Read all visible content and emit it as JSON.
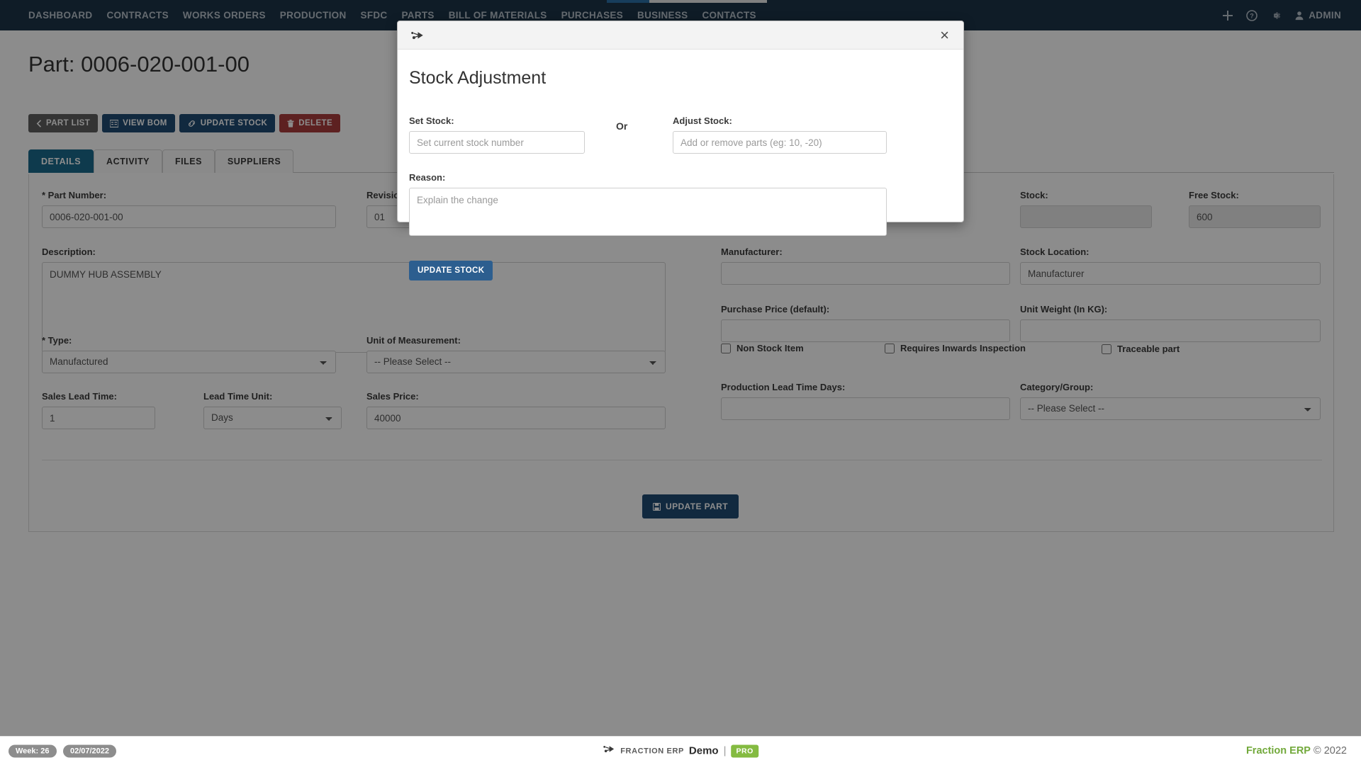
{
  "navbar": {
    "items": [
      {
        "label": "DASHBOARD",
        "name": "nav-dashboard"
      },
      {
        "label": "CONTRACTS",
        "name": "nav-contracts"
      },
      {
        "label": "WORKS ORDERS",
        "name": "nav-works-orders"
      },
      {
        "label": "PRODUCTION",
        "name": "nav-production"
      },
      {
        "label": "SFDC",
        "name": "nav-sfdc"
      },
      {
        "label": "PARTS",
        "name": "nav-parts"
      },
      {
        "label": "BILL OF MATERIALS",
        "name": "nav-bill-of-materials"
      },
      {
        "label": "PURCHASES",
        "name": "nav-purchases"
      },
      {
        "label": "BUSINESS",
        "name": "nav-business"
      },
      {
        "label": "CONTACTS",
        "name": "nav-contacts"
      }
    ],
    "icons": [
      "plus-icon",
      "help-circle-icon",
      "gear-icon"
    ],
    "user_label": "ADMIN"
  },
  "page": {
    "title": "Part: 0006-020-001-00",
    "buttons": [
      {
        "label": "PART LIST",
        "icon": "chevron-left-icon",
        "style": "grey"
      },
      {
        "label": "VIEW BOM",
        "icon": "list-icon",
        "style": "navy"
      },
      {
        "label": "UPDATE STOCK",
        "icon": "link-icon",
        "style": "navy"
      },
      {
        "label": "DELETE",
        "icon": "trash-icon",
        "style": "red"
      }
    ],
    "tabs": [
      {
        "label": "DETAILS",
        "active": true
      },
      {
        "label": "ACTIVITY",
        "active": false
      },
      {
        "label": "FILES",
        "active": false
      },
      {
        "label": "SUPPLIERS",
        "active": false
      }
    ],
    "submit_label": "UPDATE PART"
  },
  "form": {
    "part_number": {
      "label": "* Part Number:",
      "value": "0006-020-001-00"
    },
    "revision": {
      "label": "Revision:",
      "value": "01"
    },
    "stock": {
      "label": "Stock:",
      "value": ""
    },
    "free_stock": {
      "label": "Free Stock:",
      "value": "600"
    },
    "description": {
      "label": "Description:",
      "value": "DUMMY HUB ASSEMBLY"
    },
    "manufacturer": {
      "label": "Manufacturer:",
      "value": ""
    },
    "stock_location": {
      "label": "Stock Location:",
      "value": "Manufacturer"
    },
    "purchase_price": {
      "label": "Purchase Price (default):",
      "value": ""
    },
    "unit_weight": {
      "label": "Unit Weight (In KG):",
      "value": ""
    },
    "type": {
      "label": "* Type:",
      "value": "Manufactured"
    },
    "unit_of_measurement": {
      "label": "Unit of Measurement:",
      "value": "-- Please Select --"
    },
    "non_stock_item": {
      "label": "Non Stock Item",
      "checked": false
    },
    "requires_inwards_inspection": {
      "label": "Requires Inwards Inspection",
      "checked": false
    },
    "traceable_part": {
      "label": "Traceable part",
      "checked": false
    },
    "sales_lead_time": {
      "label": "Sales Lead Time:",
      "value": "1"
    },
    "lead_time_unit": {
      "label": "Lead Time Unit:",
      "value": "Days"
    },
    "sales_price": {
      "label": "Sales Price:",
      "value": "40000"
    },
    "production_lead_time_days": {
      "label": "Production Lead Time Days:",
      "value": ""
    },
    "category_group": {
      "label": "Category/Group:",
      "value": "-- Please Select --"
    }
  },
  "modal": {
    "logo_icon": "fraction-erp-logo-icon",
    "close_label": "×",
    "title": "Stock Adjustment",
    "set_stock_label": "Set Stock:",
    "set_stock_placeholder": "Set current stock number",
    "set_stock_value": "",
    "or_label": "Or",
    "adjust_stock_label": "Adjust Stock:",
    "adjust_stock_placeholder": "Add or remove parts (eg: 10, -20)",
    "adjust_stock_value": "",
    "reason_label": "Reason:",
    "reason_placeholder": "Explain the change",
    "reason_value": "",
    "submit_label": "UPDATE STOCK"
  },
  "footer": {
    "week_badge": "Week: 26",
    "date_badge": "02/07/2022",
    "brand": "FRACTION ERP",
    "instance": "Demo",
    "separator": "|",
    "plan_badge": "PRO",
    "copyright_brand": "Fraction ERP",
    "copyright_text": "© 2022"
  },
  "colors": {
    "navbar_bg": "#1d3348",
    "accent_navy": "#1f4b73",
    "accent_tab": "#1b6b8c",
    "danger_red": "#a93c3c",
    "brand_green": "#72a93b",
    "pro_green": "#84bb41"
  }
}
